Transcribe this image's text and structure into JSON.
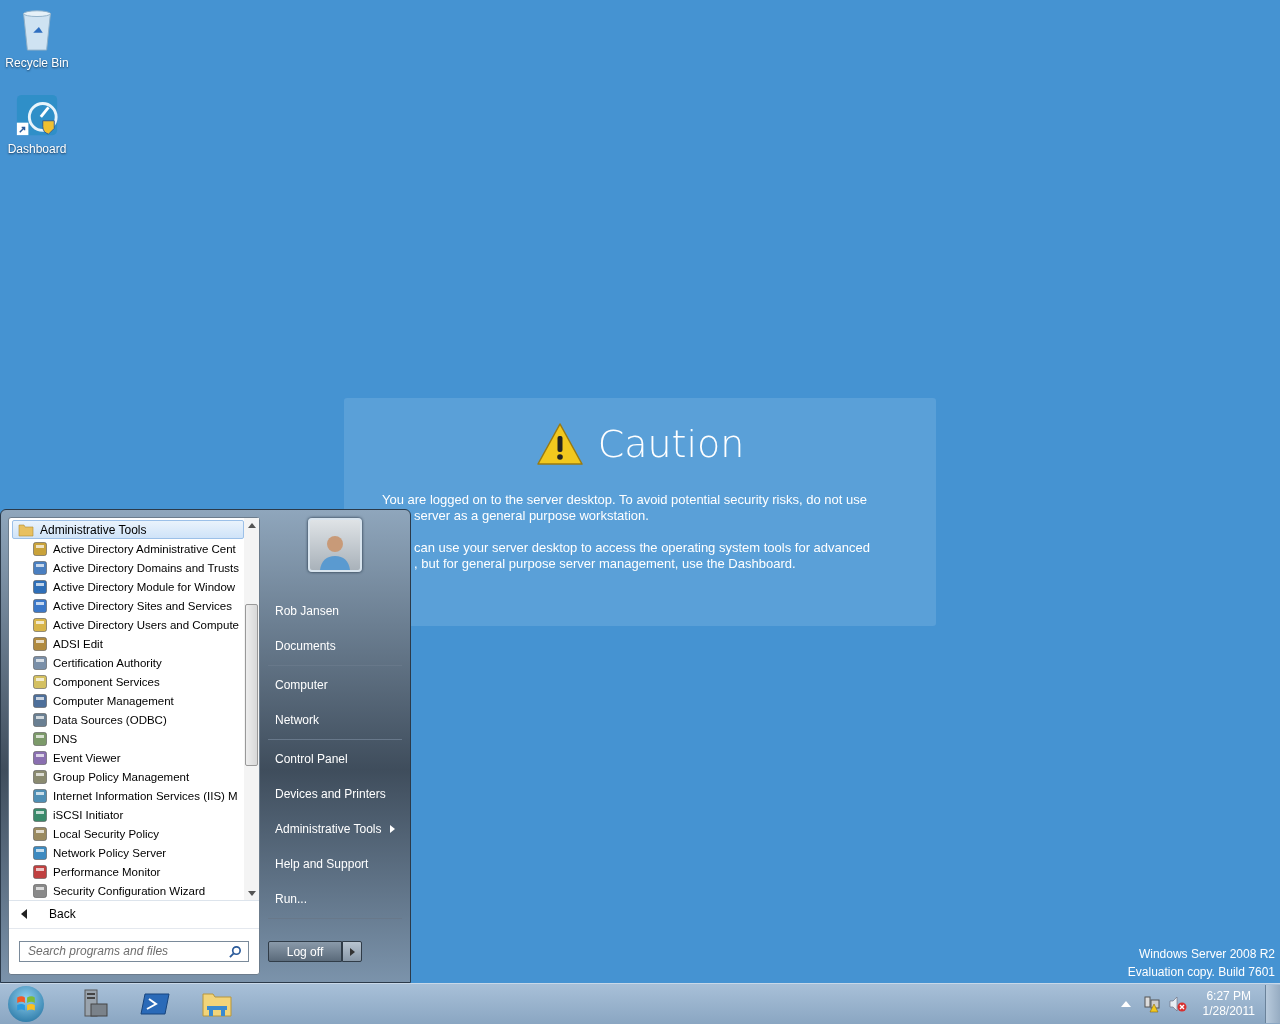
{
  "desktop_icons": [
    {
      "label": "Recycle Bin",
      "kind": "recycle"
    },
    {
      "label": "Dashboard",
      "kind": "dashboard"
    }
  ],
  "caution": {
    "title": "Caution",
    "paragraphs": [
      [
        {
          "text": "You are logged on to the server desktop. To avoid potential security risks, do not use",
          "covered": false
        },
        {
          "text": "server as a general purpose workstation.",
          "covered": true
        }
      ],
      [
        {
          "text": "can use your server desktop to access the operating system tools for advanced",
          "covered": true
        },
        {
          "text": ", but for general purpose server management, use the Dashboard.",
          "covered": true
        }
      ]
    ]
  },
  "start_menu": {
    "folder": {
      "label": "Administrative Tools",
      "selected": true
    },
    "programs": [
      "Active Directory Administrative Cent",
      "Active Directory Domains and Trusts",
      "Active Directory Module for Window",
      "Active Directory Sites and Services",
      "Active Directory Users and Compute",
      "ADSI Edit",
      "Certification Authority",
      "Component Services",
      "Computer Management",
      "Data Sources (ODBC)",
      "DNS",
      "Event Viewer",
      "Group Policy Management",
      "Internet Information Services (IIS) M",
      "iSCSI Initiator",
      "Local Security Policy",
      "Network Policy Server",
      "Performance Monitor",
      "Security Configuration Wizard"
    ],
    "back": "Back",
    "search": {
      "placeholder": "Search programs and files"
    },
    "place_groups": [
      [
        {
          "label": "Rob Jansen",
          "submenu": false
        },
        {
          "label": "Documents",
          "submenu": false
        }
      ],
      [
        {
          "label": "Computer",
          "submenu": false
        },
        {
          "label": "Network",
          "submenu": false
        }
      ],
      [
        {
          "label": "Control Panel",
          "submenu": false
        },
        {
          "label": "Devices and Printers",
          "submenu": false
        },
        {
          "label": "Administrative Tools",
          "submenu": true
        },
        {
          "label": "Help and Support",
          "submenu": false
        },
        {
          "label": "Run...",
          "submenu": false
        }
      ]
    ],
    "log_off": "Log off"
  },
  "edition_text": [
    "Windows Server 2008 R2",
    "Evaluation copy. Build 7601"
  ],
  "taskbar": {
    "pinned": [
      {
        "kind": "server"
      },
      {
        "kind": "shell"
      },
      {
        "kind": "folder"
      }
    ],
    "tray": {
      "time": "6:27 PM",
      "date": "1/28/2011"
    }
  }
}
